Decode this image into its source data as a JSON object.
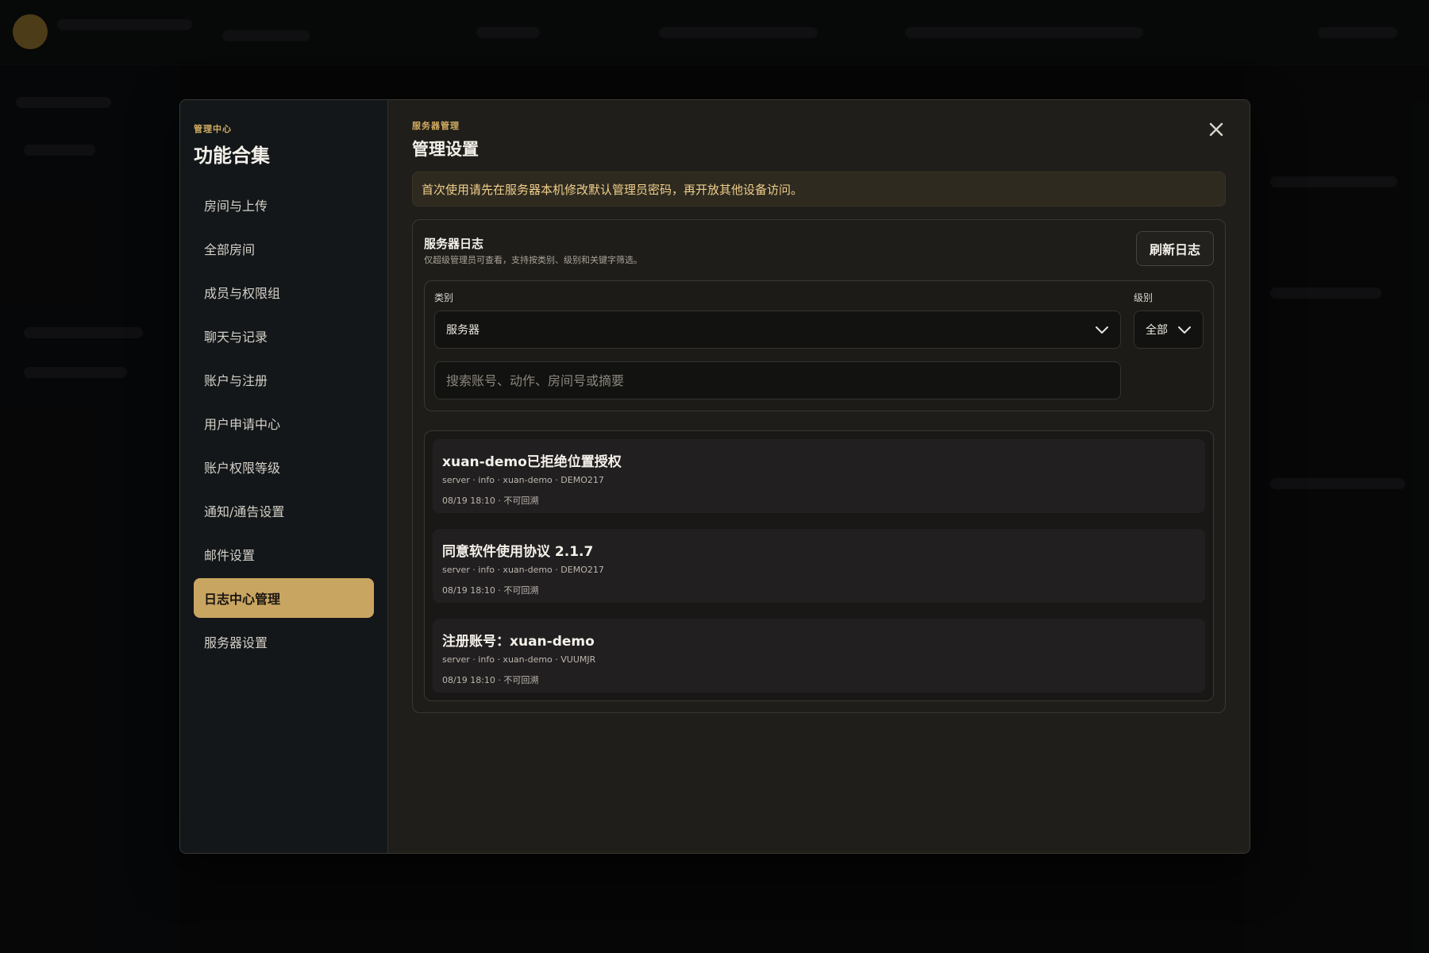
{
  "sidebar": {
    "eyebrow": "管理中心",
    "title": "功能合集",
    "items": [
      {
        "label": "房间与上传"
      },
      {
        "label": "全部房间"
      },
      {
        "label": "成员与权限组"
      },
      {
        "label": "聊天与记录"
      },
      {
        "label": "账户与注册"
      },
      {
        "label": "用户申请中心"
      },
      {
        "label": "账户权限等级"
      },
      {
        "label": "通知/通告设置"
      },
      {
        "label": "邮件设置"
      },
      {
        "label": "日志中心管理",
        "active": true
      },
      {
        "label": "服务器设置"
      }
    ]
  },
  "main": {
    "eyebrow": "服务器管理",
    "title": "管理设置",
    "notice": "首次使用请先在服务器本机修改默认管理员密码，再开放其他设备访问。",
    "log_card": {
      "title": "服务器日志",
      "subtitle": "仅超级管理员可查看，支持按类别、级别和关键字筛选。",
      "refresh_label": "刷新日志",
      "category_label": "类别",
      "category_value": "服务器",
      "level_label": "级别",
      "level_value": "全部",
      "search_placeholder": "搜索账号、动作、房间号或摘要"
    },
    "logs": [
      {
        "title": "xuan-demo已拒绝位置授权",
        "meta": "server · info · xuan-demo · DEMO217",
        "time": "08/19 18:10 · 不可回溯"
      },
      {
        "title": "同意软件使用协议 2.1.7",
        "meta": "server · info · xuan-demo · DEMO217",
        "time": "08/19 18:10 · 不可回溯"
      },
      {
        "title": "注册账号：xuan-demo",
        "meta": "server · info · xuan-demo · VUUMJR",
        "time": "08/19 18:10 · 不可回溯"
      }
    ]
  },
  "colors": {
    "accent": "#c9a562",
    "notice_text": "#f0cf8a",
    "sidebar_bg": "#13171a",
    "main_bg": "#1f1e1a"
  },
  "icons": {
    "close": "close-icon",
    "dropdown": "chevron-down-icon"
  }
}
